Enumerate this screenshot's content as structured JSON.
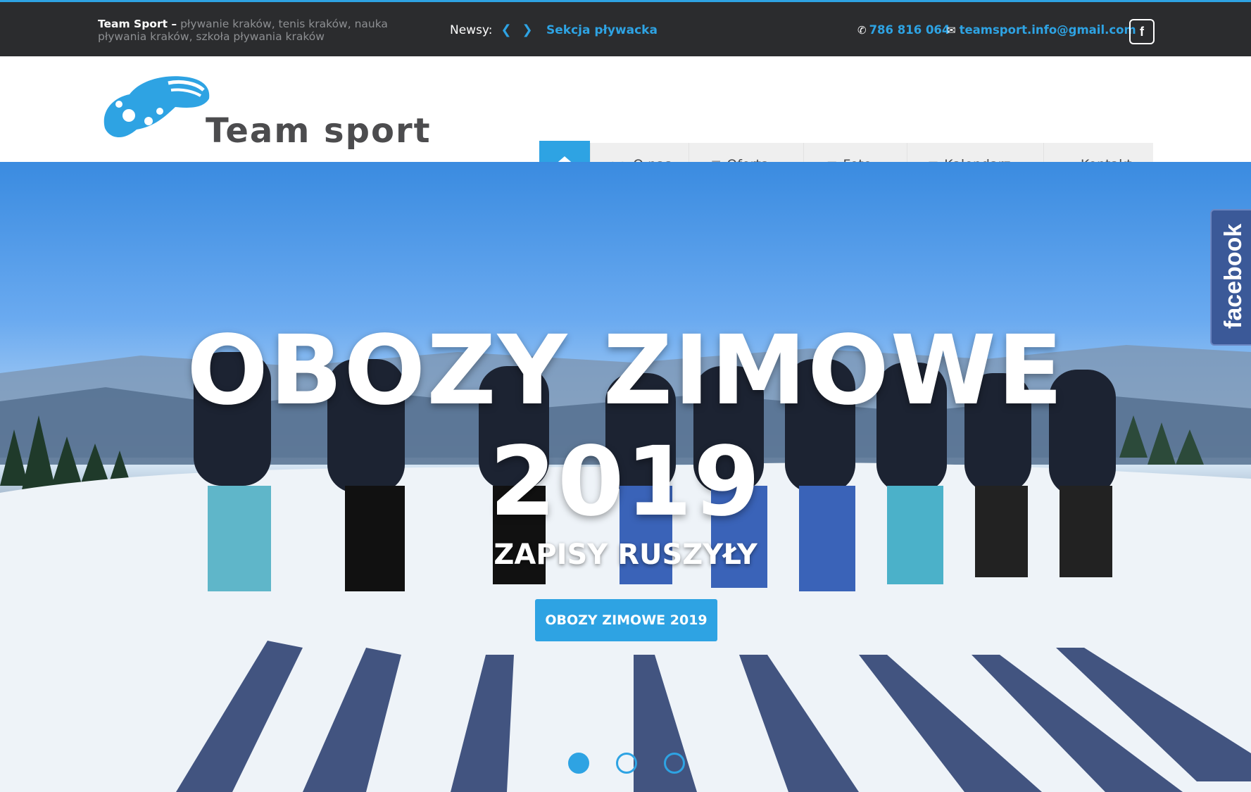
{
  "topbar": {
    "brand": "Team Sport –",
    "tagline": "pływanie kraków, tenis kraków, nauka pływania kraków, szkoła pływania kraków",
    "news_label": "Newsy:",
    "news_link": "Sekcja pływacka",
    "phone": "786 816 064",
    "email": "teamsport.info@gmail.com",
    "facebook_letter": "f"
  },
  "logo": {
    "text": "Team sport"
  },
  "nav": {
    "items": [
      {
        "label": "O nas",
        "icon": "users-icon"
      },
      {
        "label": "Oferta",
        "icon": "list-icon"
      },
      {
        "label": "Foto",
        "icon": "image-icon"
      },
      {
        "label": "Kalendarz",
        "icon": "calendar-icon"
      },
      {
        "label": "Kontakt",
        "icon": "envelope-icon"
      }
    ]
  },
  "hero": {
    "title_line1": "OBOZY ZIMOWE",
    "title_line2": "2019",
    "subtitle": "ZAPISY RUSZYŁY",
    "button": "OBOZY ZIMOWE 2019",
    "slides": 3,
    "active_slide": 1
  },
  "side_tab": {
    "label": "facebook"
  },
  "colors": {
    "accent": "#2ea3e3",
    "topbar": "#2b2c2e",
    "facebook": "#3b5998"
  }
}
